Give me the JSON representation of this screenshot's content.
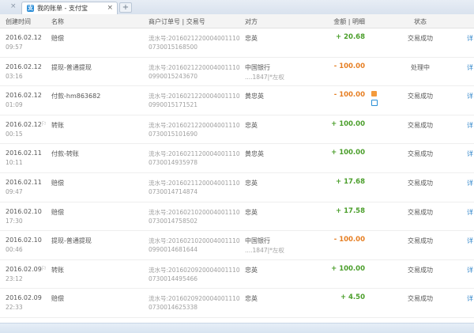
{
  "tabs": {
    "close_left": "×",
    "active_title": "我的账单 - 支付宝",
    "active_icon": "支",
    "close": "×",
    "new_tab": "+"
  },
  "columns": {
    "time": "创建时间",
    "name": "名称",
    "order": "商户订单号 | 交易号",
    "party": "对方",
    "amount": "金额 | 明细",
    "status": "状态"
  },
  "rows": [
    {
      "date": "2016.02.12",
      "time": "09:57",
      "flag": "",
      "name": "赔偿",
      "serial": "流水号:2016021220004001110",
      "trade": "0730015168500",
      "party": "忠英",
      "party2": "",
      "amount": "+ 20.68",
      "status": "交易成功",
      "detail": "详"
    },
    {
      "date": "2016.02.12",
      "time": "03:16",
      "flag": "",
      "name": "提现-普通提现",
      "serial": "流水号:2016021220004001110",
      "trade": "0990015243670",
      "party": "中国银行",
      "party2": "....1847|*左权",
      "amount": "- 100.00",
      "status": "处理中",
      "detail": "详"
    },
    {
      "date": "2016.02.12",
      "time": "01:09",
      "flag": "",
      "name": "付款-hm863682",
      "serial": "流水号:2016021220004001110",
      "trade": "0990015171521",
      "party": "黄忠英",
      "party2": "",
      "amount": "- 100.00",
      "status": "交易成功",
      "detail": "详"
    },
    {
      "date": "2016.02.12",
      "time": "00:15",
      "flag": "⚐",
      "name": "转账",
      "serial": "流水号:2016021220004001110",
      "trade": "0730015101690",
      "party": "忠英",
      "party2": "",
      "amount": "+ 100.00",
      "status": "交易成功",
      "detail": "详"
    },
    {
      "date": "2016.02.11",
      "time": "10:11",
      "flag": "",
      "name": "付款-转账",
      "serial": "流水号:2016021120004001110",
      "trade": "0730014935978",
      "party": "黄忠英",
      "party2": "",
      "amount": "+ 100.00",
      "status": "交易成功",
      "detail": "详"
    },
    {
      "date": "2016.02.11",
      "time": "09:47",
      "flag": "",
      "name": "赔偿",
      "serial": "流水号:2016021120004001110",
      "trade": "0730014714874",
      "party": "忠英",
      "party2": "",
      "amount": "+ 17.68",
      "status": "交易成功",
      "detail": "详"
    },
    {
      "date": "2016.02.10",
      "time": "17:30",
      "flag": "",
      "name": "赔偿",
      "serial": "流水号:2016021020004001110",
      "trade": "0730014758502",
      "party": "忠英",
      "party2": "",
      "amount": "+ 17.58",
      "status": "交易成功",
      "detail": "详"
    },
    {
      "date": "2016.02.10",
      "time": "00:46",
      "flag": "",
      "name": "提现-普通提现",
      "serial": "流水号:2016021020004001110",
      "trade": "0990014681644",
      "party": "中国银行",
      "party2": "....1847|*左权",
      "amount": "- 100.00",
      "status": "交易成功",
      "detail": "详"
    },
    {
      "date": "2016.02.09",
      "time": "23:12",
      "flag": "⚐",
      "name": "转账",
      "serial": "流水号:2016020920004001110",
      "trade": "0730014495466",
      "party": "忠英",
      "party2": "",
      "amount": "+ 100.00",
      "status": "交易成功",
      "detail": "详"
    },
    {
      "date": "2016.02.09",
      "time": "22:33",
      "flag": "",
      "name": "赔偿",
      "serial": "流水号:2016020920004001110",
      "trade": "0730014625338",
      "party": "忠英",
      "party2": "",
      "amount": "+ 4.50",
      "status": "交易成功",
      "detail": "详"
    }
  ],
  "colors": {
    "positive": "#4a9e2a",
    "negative": "#e67e22",
    "link": "#2a82c9"
  }
}
